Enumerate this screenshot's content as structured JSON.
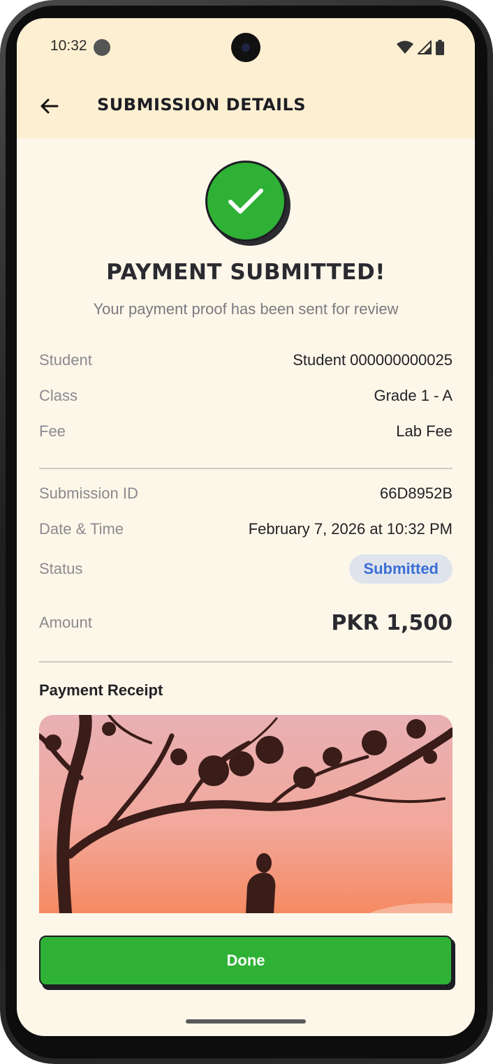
{
  "status_bar": {
    "time": "10:32"
  },
  "app_bar": {
    "title": "SUBMISSION DETAILS"
  },
  "hero": {
    "headline": "PAYMENT SUBMITTED!",
    "subline": "Your payment proof has been sent for review"
  },
  "details_top": [
    {
      "label": "Student",
      "value": "Student 000000000025"
    },
    {
      "label": "Class",
      "value": "Grade 1 - A"
    },
    {
      "label": "Fee",
      "value": "Lab Fee"
    }
  ],
  "details_bottom": {
    "submission_id_label": "Submission ID",
    "submission_id": "66D8952B",
    "datetime_label": "Date & Time",
    "datetime": "February 7, 2026 at 10:32 PM",
    "status_label": "Status",
    "status": "Submitted",
    "amount_label": "Amount",
    "amount": "PKR 1,500"
  },
  "receipt": {
    "title": "Payment Receipt"
  },
  "actions": {
    "done_label": "Done"
  },
  "colors": {
    "background": "#fdf7e9",
    "header": "#fdefd1",
    "success": "#2fb136",
    "status_badge_text": "#3a6ed6",
    "status_badge_bg": "#dfe4ec"
  }
}
